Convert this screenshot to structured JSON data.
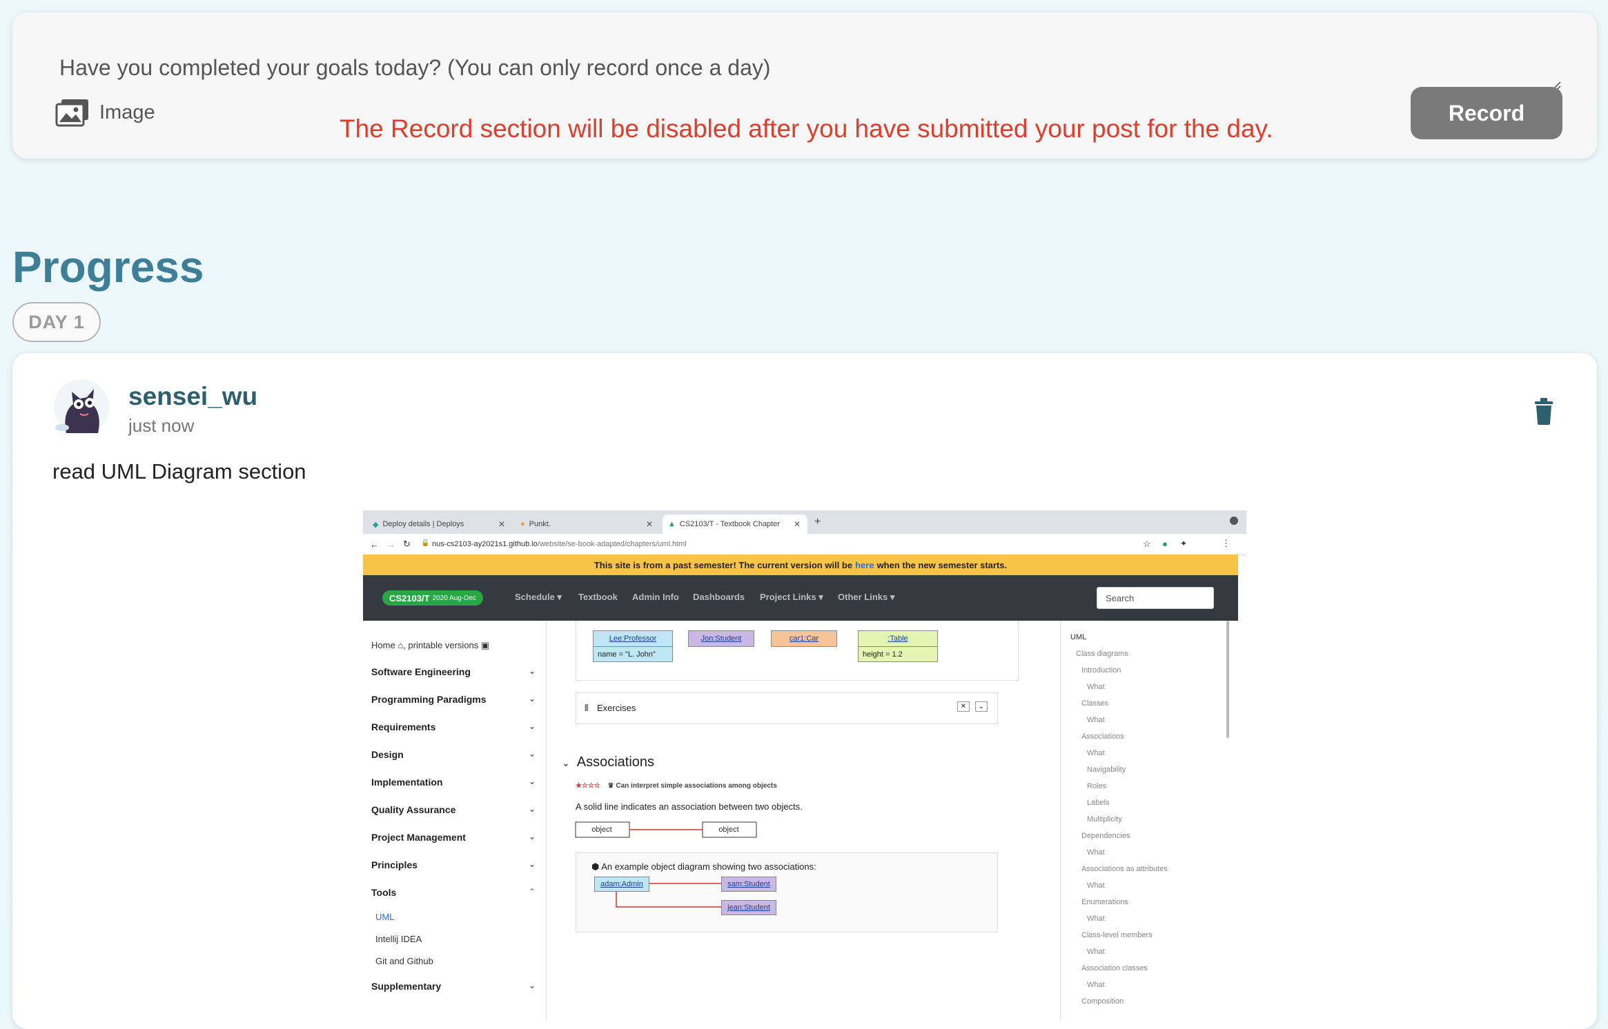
{
  "record": {
    "prompt": "Have you completed your goals today? (You can only record once a day)",
    "image_label": "Image",
    "warning": "The Record section will be disabled after you have submitted your post for the day.",
    "button": "Record"
  },
  "progress": {
    "title": "Progress",
    "day_label": "DAY 1"
  },
  "post": {
    "username": "sensei_wu",
    "time": "just now",
    "text": "read UML Diagram section"
  },
  "screenshot": {
    "tabs": [
      "Deploy details | Deploys",
      "Punkt.",
      "CS2103/T - Textbook Chapter"
    ],
    "url_host": "nus-cs2103-ay2021s1.github.io",
    "url_path": "/website/se-book-adapted/chapters/uml.html",
    "banner_pre": "This site is from a past semester! The current version will be",
    "banner_link": "here",
    "banner_post": "when the new semester starts.",
    "brand": "CS2103/T",
    "brand_sub": "2020 Aug-Dec",
    "nav": [
      "Schedule",
      "Textbook",
      "Admin Info",
      "Dashboards",
      "Project Links",
      "Other Links"
    ],
    "search_placeholder": "Search",
    "home_link": "Home",
    "printable": ", printable versions",
    "left_items": [
      "Software Engineering",
      "Programming Paradigms",
      "Requirements",
      "Design",
      "Implementation",
      "Quality Assurance",
      "Project Management",
      "Principles",
      "Tools"
    ],
    "tools_sub": [
      "UML",
      "Intellij IDEA",
      "Git and Github"
    ],
    "supplementary": "Supplementary",
    "uml_objects": {
      "lee_head": "Lee:Professor",
      "lee_body": "name = \"L. John\"",
      "jon": "Jon:Student",
      "car": "car1:Car",
      "table_head": ":Table",
      "table_body": "height = 1.2"
    },
    "exercises": "Exercises",
    "associations_heading": "Associations",
    "outcome": "Can interpret simple associations among objects",
    "solid_line_text": "A solid line indicates an association between two objects.",
    "object_label": "object",
    "example_caption": "An example object diagram showing two associations:",
    "example_objects": [
      "adam:Admin",
      "sam:Student",
      "jean:Student"
    ],
    "toc": [
      "UML",
      "Class diagrams",
      "Introduction",
      "What",
      "Classes",
      "What",
      "Associations",
      "What",
      "Navigability",
      "Roles",
      "Labels",
      "Multiplicity",
      "Dependencies",
      "What",
      "Associations as attributes",
      "What",
      "Enumerations",
      "What",
      "Class-level members",
      "What",
      "Association classes",
      "What",
      "Composition"
    ]
  }
}
